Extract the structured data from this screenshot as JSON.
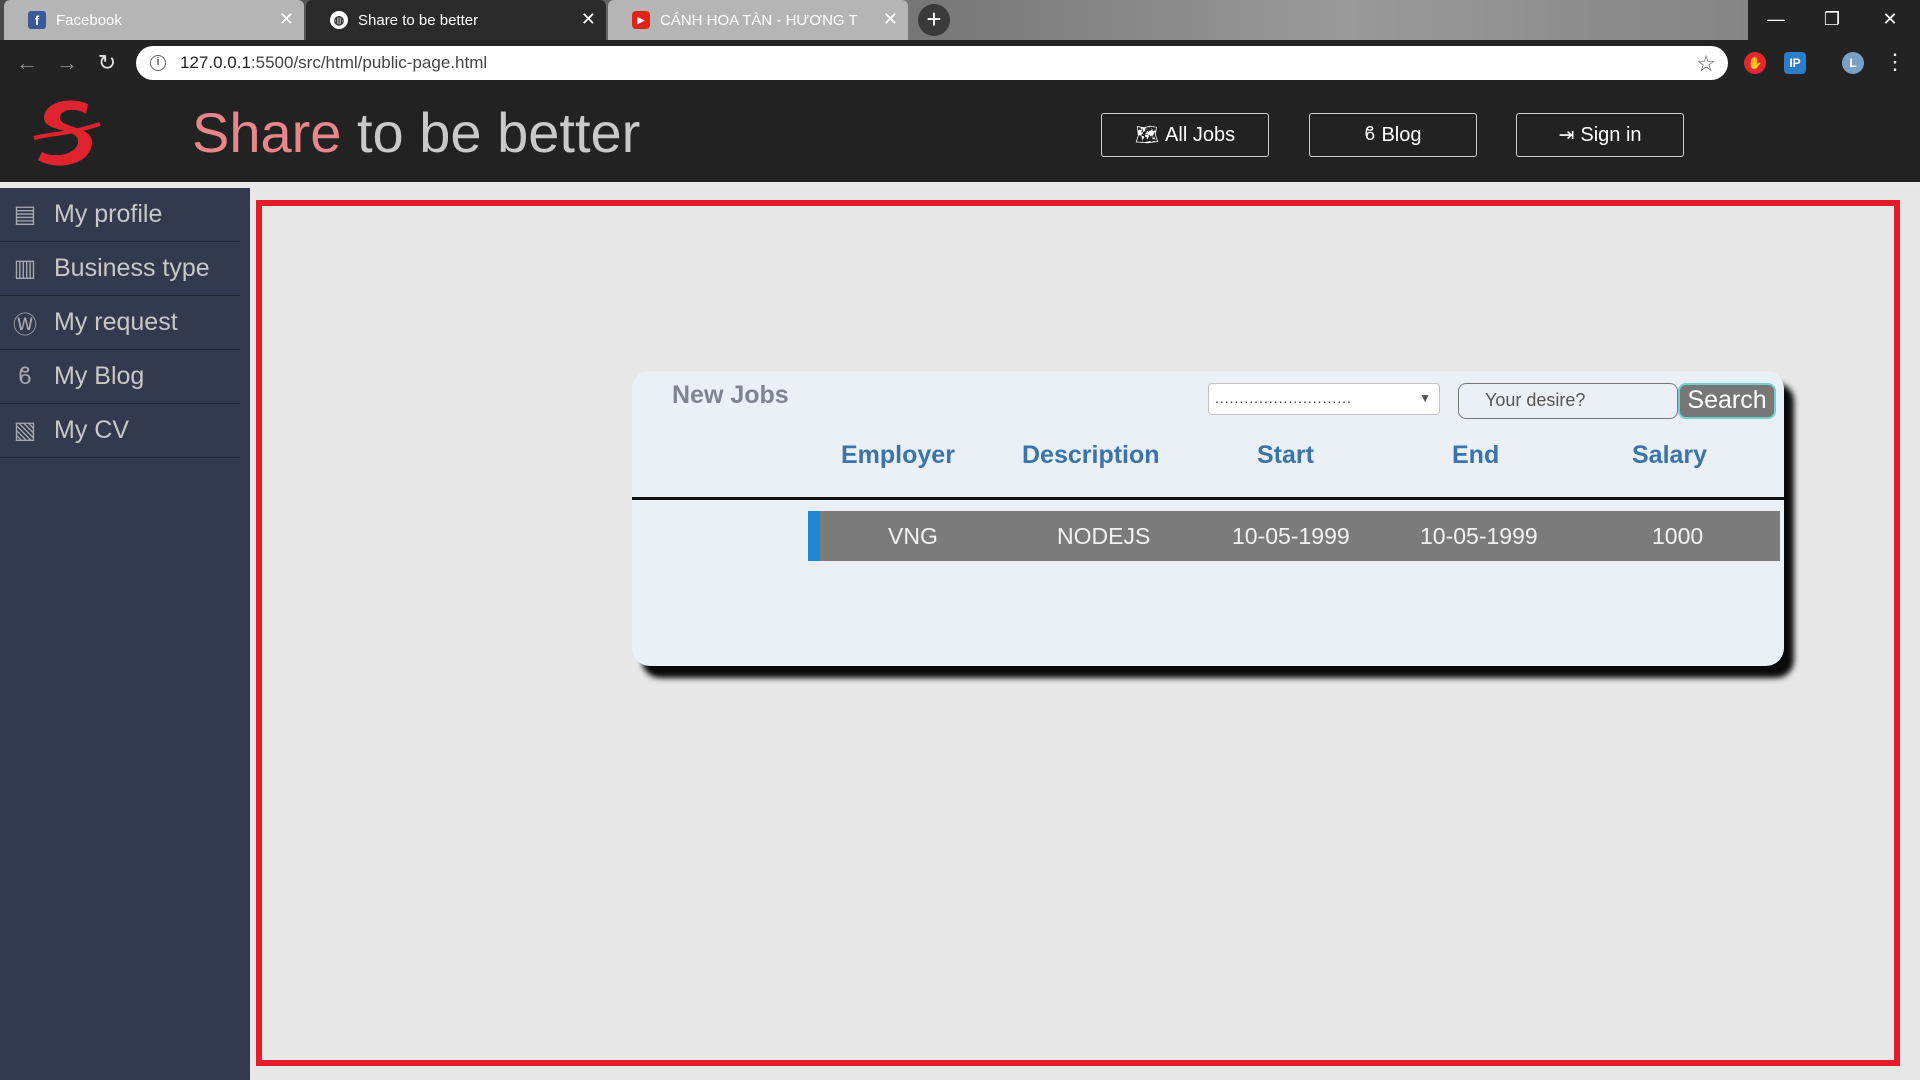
{
  "browser": {
    "tabs": [
      {
        "title": "Facebook",
        "icon": "facebook-icon"
      },
      {
        "title": "Share to be better",
        "icon": "globe-icon"
      },
      {
        "title": "CÁNH HOA TÀN - HƯƠNG T",
        "icon": "youtube-icon"
      }
    ],
    "url_host": "127.0.0.1",
    "url_rest": ":5500/src/html/public-page.html"
  },
  "header": {
    "brand_accent": "Share",
    "brand_rest": " to be better",
    "buttons": {
      "all_jobs": "All Jobs",
      "blog": "Blog",
      "sign_in": "Sign in"
    }
  },
  "sidebar": {
    "items": [
      {
        "label": "My profile",
        "icon": "id-card-icon"
      },
      {
        "label": "Business type",
        "icon": "building-icon"
      },
      {
        "label": "My request",
        "icon": "wordpress-icon"
      },
      {
        "label": "My Blog",
        "icon": "blog-icon"
      },
      {
        "label": "My CV",
        "icon": "word-file-icon"
      }
    ]
  },
  "jobs": {
    "title": "New Jobs",
    "filter_value": "............................",
    "search_placeholder": "Your desire?",
    "search_button": "Search",
    "columns": [
      "Employer",
      "Description",
      "Start",
      "End",
      "Salary"
    ],
    "rows": [
      {
        "employer": "VNG",
        "description": "NODEJS",
        "start": "10-05-1999",
        "end": "10-05-1999",
        "salary": "1000"
      }
    ]
  },
  "colors": {
    "accent_red": "#e31c2a",
    "header_bg": "#222222",
    "sidebar_bg": "#333a4d",
    "column_header": "#3a74a8",
    "row_marker": "#1e88d6"
  }
}
